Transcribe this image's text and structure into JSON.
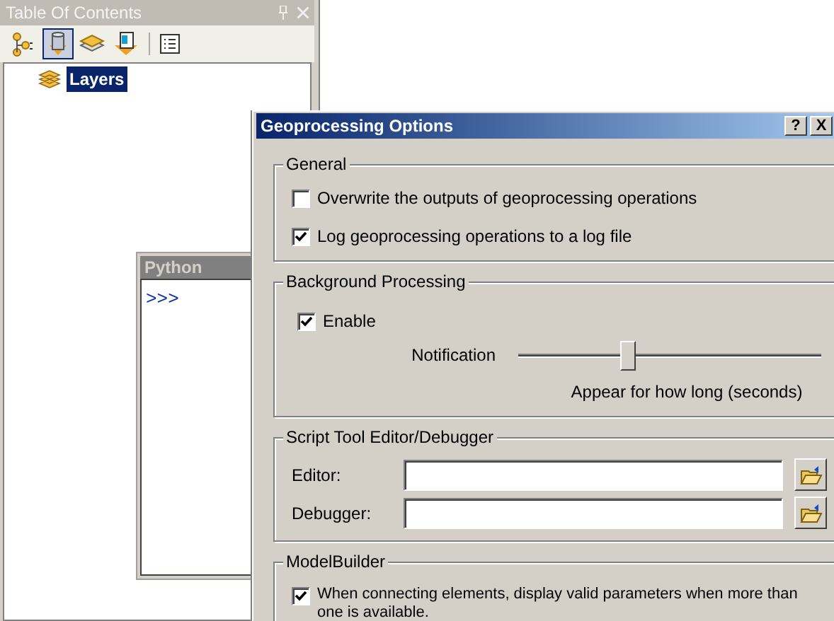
{
  "toc": {
    "title": "Table Of Contents",
    "toolbar": [
      {
        "kind": "list-by-drawing-order",
        "selected": false
      },
      {
        "kind": "list-by-source",
        "selected": true
      },
      {
        "kind": "list-by-visibility",
        "selected": false
      },
      {
        "kind": "list-by-selection",
        "selected": false
      },
      {
        "kind": "options",
        "selected": false
      }
    ],
    "tree": [
      {
        "label": "Layers",
        "selected": true
      }
    ]
  },
  "python": {
    "title": "Python",
    "prompt": ">>>"
  },
  "dialog": {
    "title": "Geoprocessing Options",
    "help": "?",
    "close": "X",
    "general": {
      "title": "General",
      "options": [
        {
          "label": "Overwrite the outputs of geoprocessing operations",
          "checked": false
        },
        {
          "label": "Log geoprocessing operations to a log file",
          "checked": true
        }
      ]
    },
    "background": {
      "title": "Background Processing",
      "enable": {
        "label": "Enable",
        "checked": true
      },
      "notification": {
        "label": "Notification",
        "level": 0.36,
        "caption": "Appear for how long (seconds)"
      }
    },
    "script": {
      "title": "Script Tool Editor/Debugger",
      "fields": [
        {
          "label": "Editor:"
        },
        {
          "label": "Debugger:"
        }
      ]
    },
    "modelbuilder": {
      "title": "ModelBuilder",
      "option": {
        "label": "When connecting elements, display valid parameters when more than one is available.",
        "checked": true
      }
    }
  }
}
